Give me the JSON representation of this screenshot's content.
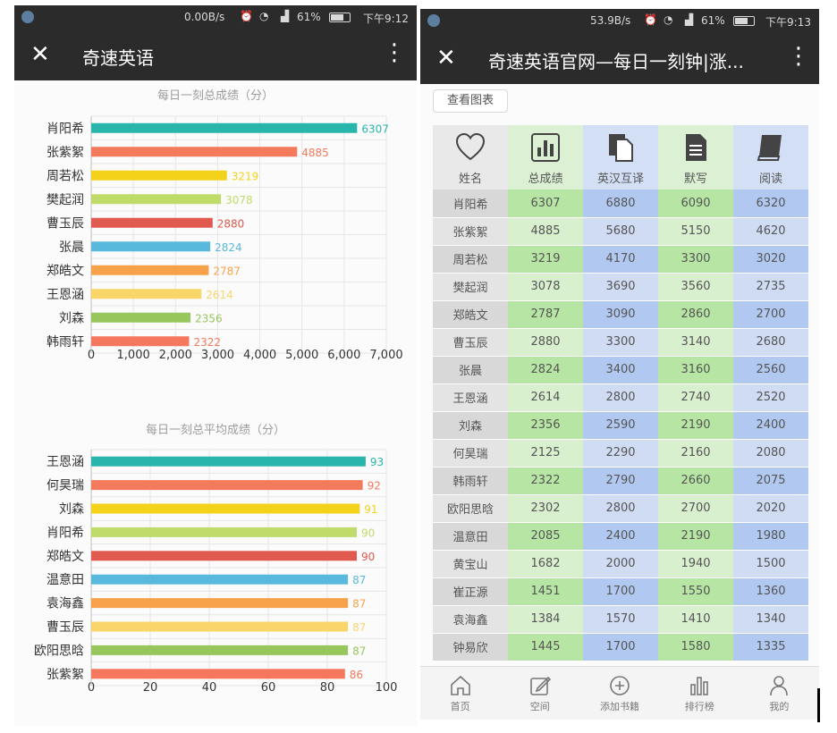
{
  "left_screen": {
    "status": {
      "network": "0.00B/s",
      "battery": "61%",
      "time": "下午9:12"
    },
    "title": "奇速英语"
  },
  "right_screen": {
    "status": {
      "network": "53.9B/s",
      "battery": "61%",
      "time": "下午9:13"
    },
    "title": "奇速英语官网—每日一刻钟|涨...",
    "view_chart_button": "查看图表",
    "table": {
      "headers": [
        "姓名",
        "总成绩",
        "英汉互译",
        "默写",
        "阅读"
      ],
      "rows": [
        [
          "肖阳希",
          "6307",
          "6880",
          "6090",
          "6320"
        ],
        [
          "张紫絮",
          "4885",
          "5680",
          "5150",
          "4620"
        ],
        [
          "周若松",
          "3219",
          "4170",
          "3300",
          "3020"
        ],
        [
          "樊起润",
          "3078",
          "3690",
          "3560",
          "2735"
        ],
        [
          "郑皓文",
          "2787",
          "3090",
          "2860",
          "2700"
        ],
        [
          "曹玉辰",
          "2880",
          "3300",
          "3140",
          "2680"
        ],
        [
          "张晨",
          "2824",
          "3400",
          "3160",
          "2560"
        ],
        [
          "王恩涵",
          "2614",
          "2800",
          "2740",
          "2520"
        ],
        [
          "刘森",
          "2356",
          "2590",
          "2190",
          "2400"
        ],
        [
          "何昊瑞",
          "2125",
          "2290",
          "2160",
          "2080"
        ],
        [
          "韩雨轩",
          "2322",
          "2790",
          "2660",
          "2075"
        ],
        [
          "欧阳思晗",
          "2302",
          "2800",
          "2700",
          "2020"
        ],
        [
          "温意田",
          "2085",
          "2400",
          "2190",
          "1980"
        ],
        [
          "黄宝山",
          "1682",
          "2000",
          "1940",
          "1500"
        ],
        [
          "崔正源",
          "1451",
          "1700",
          "1550",
          "1360"
        ],
        [
          "袁海鑫",
          "1384",
          "1570",
          "1410",
          "1340"
        ],
        [
          "钟易欣",
          "1445",
          "1700",
          "1580",
          "1335"
        ]
      ]
    },
    "bottom_nav": [
      "首页",
      "空间",
      "添加书籍",
      "排行榜",
      "我的"
    ]
  },
  "chart_data": [
    {
      "type": "bar",
      "orientation": "horizontal",
      "title": "每日一刻总成绩（分）",
      "categories": [
        "肖阳希",
        "张紫絮",
        "周若松",
        "樊起润",
        "曹玉辰",
        "张晨",
        "郑皓文",
        "王恩涵",
        "刘森",
        "韩雨轩"
      ],
      "values": [
        6307,
        4885,
        3219,
        3078,
        2880,
        2824,
        2787,
        2614,
        2356,
        2322
      ],
      "value_labels": [
        "6307",
        "4885",
        "3219",
        "3078",
        "2880",
        "2824",
        "2787",
        "2614",
        "2356",
        "2322"
      ],
      "xlim": [
        0,
        7000
      ],
      "xticks": [
        0,
        1000,
        2000,
        3000,
        4000,
        5000,
        6000,
        7000
      ],
      "xtick_labels": [
        "0",
        "1,000",
        "2,000",
        "3,000",
        "4,000",
        "5,000",
        "6,000",
        "7,000"
      ],
      "grid": true,
      "colors": [
        "#27b5ac",
        "#f47a5c",
        "#f5d21a",
        "#bfdc6b",
        "#e05a4f",
        "#59b9dc",
        "#f7a24a",
        "#f9d56a",
        "#97c65c",
        "#f5785e"
      ]
    },
    {
      "type": "bar",
      "orientation": "horizontal",
      "title": "每日一刻总平均成绩（分）",
      "categories": [
        "王恩涵",
        "何昊瑞",
        "刘森",
        "肖阳希",
        "郑皓文",
        "温意田",
        "袁海鑫",
        "曹玉辰",
        "欧阳思晗",
        "张紫絮"
      ],
      "values": [
        93,
        92,
        91,
        90,
        90,
        87,
        87,
        87,
        87,
        86
      ],
      "value_labels": [
        "93",
        "92",
        "91",
        "90",
        "90",
        "87",
        "87",
        "87",
        "87",
        "86"
      ],
      "xlim": [
        0,
        100
      ],
      "xticks": [
        0,
        20,
        40,
        60,
        80,
        100
      ],
      "xtick_labels": [
        "0",
        "20",
        "40",
        "60",
        "80",
        "100"
      ],
      "grid": true,
      "colors": [
        "#27b5ac",
        "#f47a5c",
        "#f5d21a",
        "#bfdc6b",
        "#e05a4f",
        "#59b9dc",
        "#f7a24a",
        "#f9d56a",
        "#97c65c",
        "#f5785e"
      ]
    }
  ]
}
